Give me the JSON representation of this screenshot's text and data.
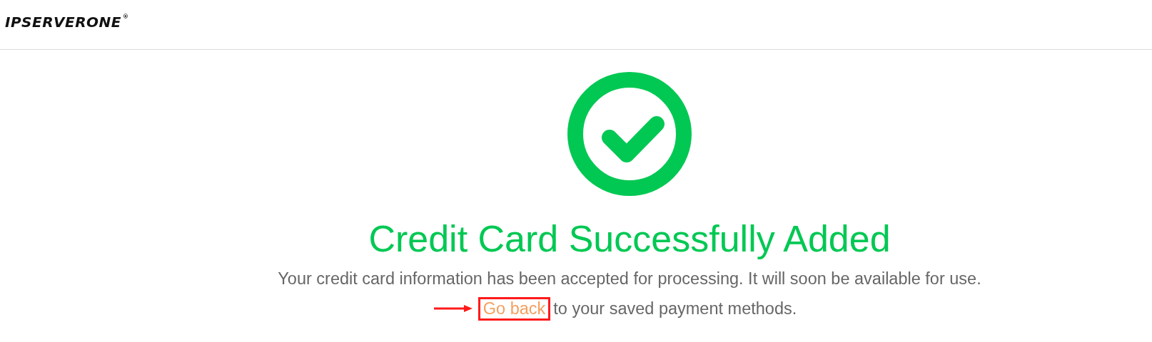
{
  "header": {
    "logo": "IPSERVERONE",
    "logo_mark": "®"
  },
  "message": {
    "title": "Credit Card Successfully Added",
    "body": "Your credit card information has been accepted for processing. It will soon be available for use.",
    "link": "Go back",
    "link_suffix": "to your saved payment methods.",
    "link_highlighted": true
  }
}
